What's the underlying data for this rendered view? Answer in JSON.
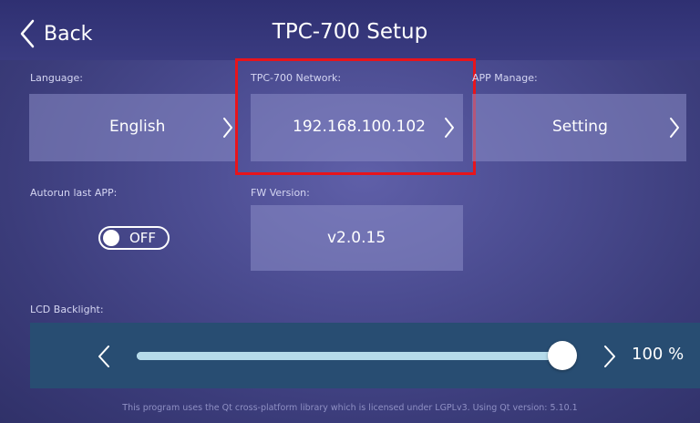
{
  "header": {
    "back_label": "Back",
    "title": "TPC-700 Setup"
  },
  "language": {
    "label": "Language:",
    "value": "English"
  },
  "network": {
    "label": "TPC-700 Network:",
    "value": "192.168.100.102"
  },
  "app_manage": {
    "label": "APP Manage:",
    "value": "Setting"
  },
  "autorun": {
    "label": "Autorun last APP:",
    "state": "OFF"
  },
  "firmware": {
    "label": "FW Version:",
    "value": "v2.0.15"
  },
  "backlight": {
    "label": "LCD Backlight:",
    "level_percent": 100,
    "value_text": "100 %"
  },
  "footer": {
    "text": "This program uses the Qt cross-platform library which is licensed under LGPLv3. Using Qt version: 5.10.1"
  },
  "colors": {
    "background": "#4c4d92",
    "header": "#2f3072",
    "tile": "#8b8dc6",
    "slider_panel": "#284d72",
    "highlight": "#e8141b"
  },
  "icons": {
    "back": "chevron-left-icon",
    "next": "chevron-right-icon"
  }
}
